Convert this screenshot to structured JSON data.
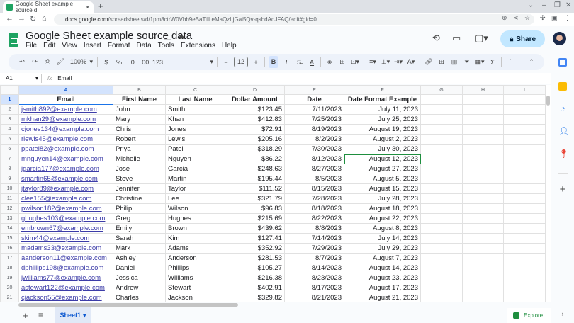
{
  "browser": {
    "tab_title": "Google Sheet example source d",
    "url_domain": "docs.google.com",
    "url_path": "/spreadsheets/d/1pm8ctrW0Vbb9eBaTiILeMaQzLjGai5Qv-qsbdAqJFAQ/edit#gid=0"
  },
  "doc": {
    "title": "Google Sheet example source data",
    "menu": [
      "File",
      "Edit",
      "View",
      "Insert",
      "Format",
      "Data",
      "Tools",
      "Extensions",
      "Help"
    ],
    "share_label": "Share"
  },
  "toolbar": {
    "zoom": "100%",
    "currency": "$",
    "percent": "%",
    "dec_decrease": ".0",
    "dec_increase": ".00",
    "format_number": "123",
    "font_size": "12",
    "bold": "B",
    "italic": "I"
  },
  "formula_bar": {
    "cell_ref": "A1",
    "fx": "fx",
    "value": "Email"
  },
  "grid": {
    "columns": [
      "A",
      "B",
      "C",
      "D",
      "E",
      "F",
      "G",
      "H",
      "I"
    ],
    "headers": [
      "Email",
      "First Name",
      "Last Name",
      "Dollar Amount",
      "Date",
      "Date Format Example"
    ],
    "rows": [
      [
        "jsmith892@example.com",
        "John",
        "Smith",
        "$123.45",
        "7/11/2023",
        "July 11, 2023"
      ],
      [
        "mkhan29@example.com",
        "Mary",
        "Khan",
        "$412.83",
        "7/25/2023",
        "July 25, 2023"
      ],
      [
        "cjones134@example.com",
        "Chris",
        "Jones",
        "$72.91",
        "8/19/2023",
        "August 19, 2023"
      ],
      [
        "rlewis45@example.com",
        "Robert",
        "Lewis",
        "$205.16",
        "8/2/2023",
        "August 2, 2023"
      ],
      [
        "ppatel82@example.com",
        "Priya",
        "Patel",
        "$318.29",
        "7/30/2023",
        "July 30, 2023"
      ],
      [
        "mnguyen14@example.com",
        "Michelle",
        "Nguyen",
        "$86.22",
        "8/12/2023",
        "August 12, 2023"
      ],
      [
        "jgarcia177@example.com",
        "Jose",
        "Garcia",
        "$248.63",
        "8/27/2023",
        "August 27, 2023"
      ],
      [
        "smartin65@example.com",
        "Steve",
        "Martin",
        "$195.44",
        "8/5/2023",
        "August 5, 2023"
      ],
      [
        "jtaylor89@example.com",
        "Jennifer",
        "Taylor",
        "$111.52",
        "8/15/2023",
        "August 15, 2023"
      ],
      [
        "clee155@example.com",
        "Christine",
        "Lee",
        "$321.79",
        "7/28/2023",
        "July 28, 2023"
      ],
      [
        "pwilson182@example.com",
        "Philip",
        "Wilson",
        "$96.83",
        "8/18/2023",
        "August 18, 2023"
      ],
      [
        "ghughes103@example.com",
        "Greg",
        "Hughes",
        "$215.69",
        "8/22/2023",
        "August 22, 2023"
      ],
      [
        "embrown67@example.com",
        "Emily",
        "Brown",
        "$439.62",
        "8/8/2023",
        "August 8, 2023"
      ],
      [
        "skim44@example.com",
        "Sarah",
        "Kim",
        "$127.41",
        "7/14/2023",
        "July 14, 2023"
      ],
      [
        "madams33@example.com",
        "Mark",
        "Adams",
        "$352.92",
        "7/29/2023",
        "July 29, 2023"
      ],
      [
        "aanderson11@example.com",
        "Ashley",
        "Anderson",
        "$281.53",
        "8/7/2023",
        "August 7, 2023"
      ],
      [
        "dphillips198@example.com",
        "Daniel",
        "Phillips",
        "$105.27",
        "8/14/2023",
        "August 14, 2023"
      ],
      [
        "jwilliams77@example.com",
        "Jessica",
        "Williams",
        "$216.38",
        "8/23/2023",
        "August 23, 2023"
      ],
      [
        "astewart122@example.com",
        "Andrew",
        "Stewart",
        "$402.91",
        "8/17/2023",
        "August 17, 2023"
      ],
      [
        "cjackson55@example.com",
        "Charles",
        "Jackson",
        "$329.82",
        "8/21/2023",
        "August 21, 2023"
      ]
    ]
  },
  "sheets": {
    "active": "Sheet1"
  },
  "explore_label": "Explore",
  "colors": {
    "accent": "#0b57d0",
    "link": "#3c3ca8",
    "highlight_border": "#1e8e3e",
    "share_bg": "#c2e7ff"
  }
}
